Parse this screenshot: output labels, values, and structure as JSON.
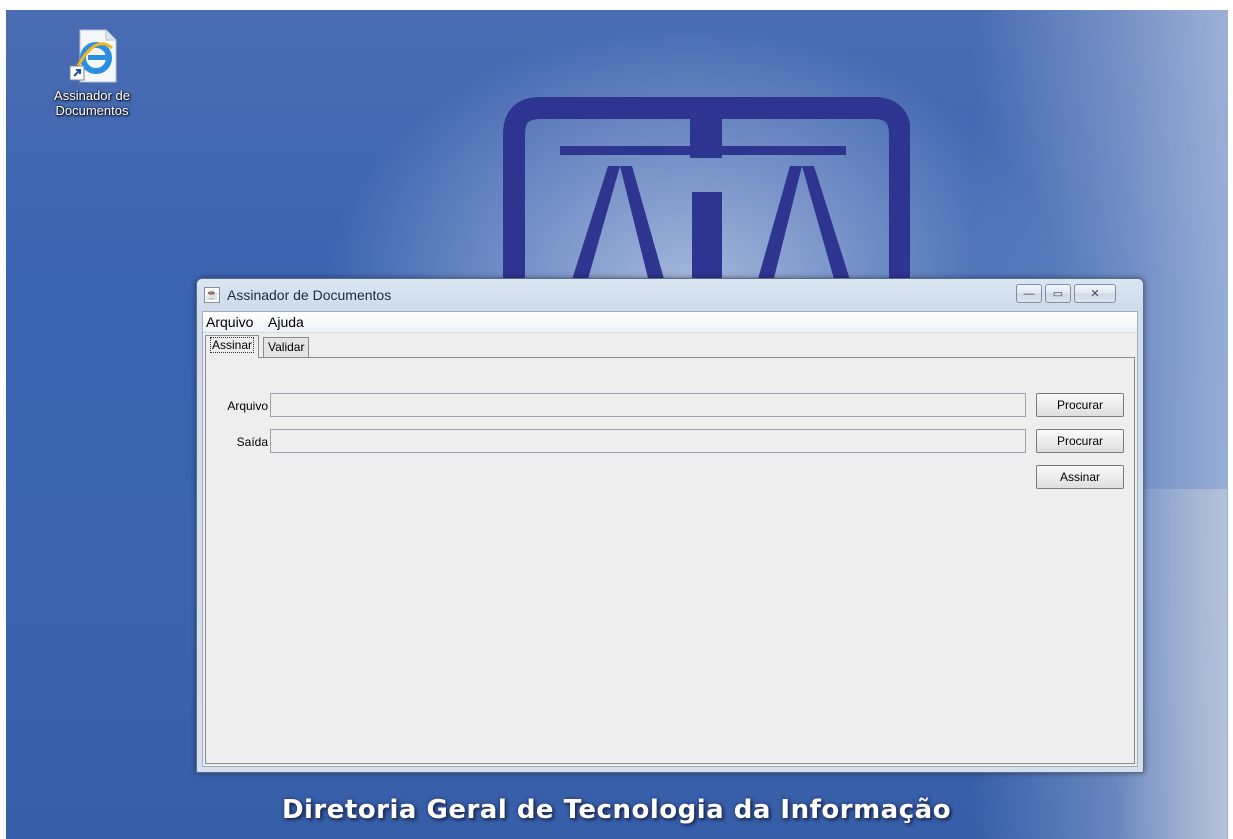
{
  "desktop": {
    "icon": {
      "name": "internet-explorer-shortcut",
      "label": "Assinador de\nDocumentos"
    },
    "banner_text": "Diretoria Geral de Tecnologia da Informação"
  },
  "window": {
    "title": "Assinador de Documentos",
    "icon": "java-cup-icon",
    "controls": {
      "minimize": "—",
      "maximize": "▭",
      "close": "✕"
    },
    "menu": [
      {
        "label": "Arquivo"
      },
      {
        "label": "Ajuda"
      }
    ],
    "tabs": [
      {
        "label": "Assinar",
        "selected": true
      },
      {
        "label": "Validar",
        "selected": false
      }
    ],
    "form": {
      "arquivo_label": "Arquivo",
      "arquivo_value": "",
      "saida_label": "Saída",
      "saida_value": "",
      "procurar_label": "Procurar",
      "assinar_label": "Assinar"
    }
  },
  "colors": {
    "desktop_blue": "#3c64ae",
    "emblem_navy": "#2e3590",
    "window_frame": "#d4e0ee",
    "panel_bg": "#eeeeee"
  }
}
